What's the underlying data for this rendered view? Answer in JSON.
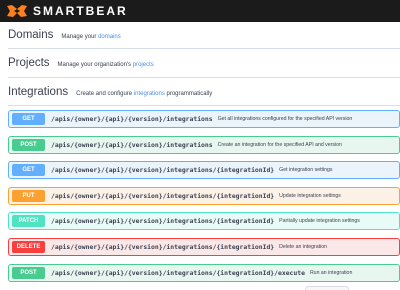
{
  "brand": {
    "name": "SMARTBEAR",
    "accent": "#ff7f1e"
  },
  "sections": {
    "domains": {
      "title": "Domains",
      "desc_prefix": "Manage your ",
      "link": "domains",
      "desc_suffix": ""
    },
    "projects": {
      "title": "Projects",
      "desc_prefix": "Manage your organization's ",
      "link": "projects",
      "desc_suffix": ""
    },
    "integrations": {
      "title": "Integrations",
      "desc_prefix": "Create and configure ",
      "link": "integrations",
      "desc_suffix": " programmatically"
    }
  },
  "operations": [
    {
      "method": "GET",
      "path": "/apis/{owner}/{api}/{version}/integrations",
      "summary": "Get all integrations configured for the specified API version"
    },
    {
      "method": "POST",
      "path": "/apis/{owner}/{api}/{version}/integrations",
      "summary": "Create an integration for the specified API and version"
    },
    {
      "method": "GET",
      "path": "/apis/{owner}/{api}/{version}/integrations/{integrationId}",
      "summary": "Get integration settings"
    },
    {
      "method": "PUT",
      "path": "/apis/{owner}/{api}/{version}/integrations/{integrationId}",
      "summary": "Update integration settings"
    },
    {
      "method": "PATCH",
      "path": "/apis/{owner}/{api}/{version}/integrations/{integrationId}",
      "summary": "Partially update integration settings"
    },
    {
      "method": "DELETE",
      "path": "/apis/{owner}/{api}/{version}/integrations/{integrationId}",
      "summary": "Delete an integration"
    },
    {
      "method": "POST",
      "path": "/apis/{owner}/{api}/{version}/integrations/{integrationId}/execute",
      "summary": "Run an integration"
    }
  ],
  "method_colors": {
    "GET": {
      "badge": "#61affe",
      "bg": "#ebf3fb",
      "border": "#61affe"
    },
    "POST": {
      "badge": "#49cc90",
      "bg": "#e8f6f0",
      "border": "#49cc90"
    },
    "PUT": {
      "badge": "#fca130",
      "bg": "#fbf1e6",
      "border": "#fca130"
    },
    "PATCH": {
      "badge": "#50e3c2",
      "bg": "#e8fbf6",
      "border": "#50e3c2"
    },
    "DELETE": {
      "badge": "#f93e3e",
      "bg": "#fae7e7",
      "border": "#f93e3e"
    }
  }
}
